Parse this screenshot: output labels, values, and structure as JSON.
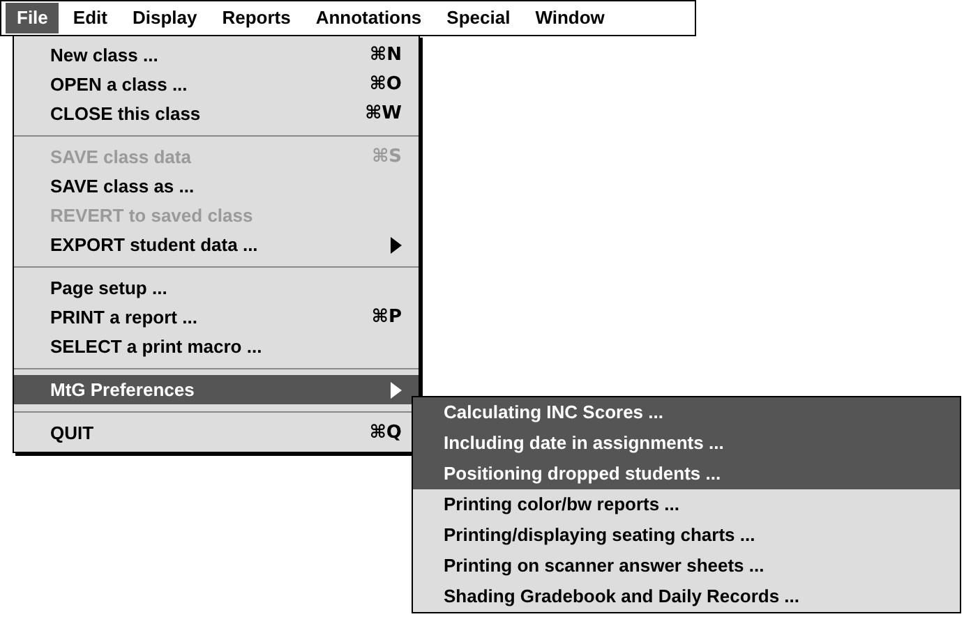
{
  "menu_bar": [
    {
      "label": "File",
      "selected": true
    },
    {
      "label": "Edit",
      "selected": false
    },
    {
      "label": "Display",
      "selected": false
    },
    {
      "label": "Reports",
      "selected": false
    },
    {
      "label": "Annotations",
      "selected": false
    },
    {
      "label": "Special",
      "selected": false
    },
    {
      "label": "Window",
      "selected": false
    }
  ],
  "file_menu": [
    {
      "kind": "item",
      "label": "New class ...",
      "shortcut": "⌘N",
      "disabled": false,
      "selected": false,
      "submenu": false
    },
    {
      "kind": "item",
      "label": "OPEN a class ...",
      "shortcut": "⌘O",
      "disabled": false,
      "selected": false,
      "submenu": false
    },
    {
      "kind": "item",
      "label": "CLOSE this class",
      "shortcut": "⌘W",
      "disabled": false,
      "selected": false,
      "submenu": false
    },
    {
      "kind": "divider"
    },
    {
      "kind": "item",
      "label": "SAVE class data",
      "shortcut": "⌘S",
      "disabled": true,
      "selected": false,
      "submenu": false
    },
    {
      "kind": "item",
      "label": "SAVE class as ...",
      "disabled": false,
      "selected": false,
      "submenu": false
    },
    {
      "kind": "item",
      "label": "REVERT to saved class",
      "disabled": true,
      "selected": false,
      "submenu": false
    },
    {
      "kind": "item",
      "label": "EXPORT student data ...",
      "disabled": false,
      "selected": false,
      "submenu": true
    },
    {
      "kind": "divider"
    },
    {
      "kind": "item",
      "label": "Page setup ...",
      "disabled": false,
      "selected": false,
      "submenu": false
    },
    {
      "kind": "item",
      "label": "PRINT a report ...",
      "shortcut": "⌘P",
      "disabled": false,
      "selected": false,
      "submenu": false
    },
    {
      "kind": "item",
      "label": "SELECT a print macro ...",
      "disabled": false,
      "selected": false,
      "submenu": false
    },
    {
      "kind": "divider"
    },
    {
      "kind": "item",
      "label": "MtG Preferences",
      "disabled": false,
      "selected": true,
      "submenu": true
    },
    {
      "kind": "divider"
    },
    {
      "kind": "item",
      "label": "QUIT",
      "shortcut": "⌘Q",
      "disabled": false,
      "selected": false,
      "submenu": false
    }
  ],
  "preferences_submenu": [
    {
      "label": "Calculating INC Scores ...",
      "selected": true
    },
    {
      "label": "Including date in assignments ...",
      "selected": true
    },
    {
      "label": "Positioning dropped students ...",
      "selected": true
    },
    {
      "label": "Printing color/bw reports ...",
      "selected": false
    },
    {
      "label": "Printing/displaying seating charts ...",
      "selected": false
    },
    {
      "label": "Printing on scanner answer sheets ...",
      "selected": false
    },
    {
      "label": "Shading Gradebook and Daily Records ...",
      "selected": false
    }
  ]
}
